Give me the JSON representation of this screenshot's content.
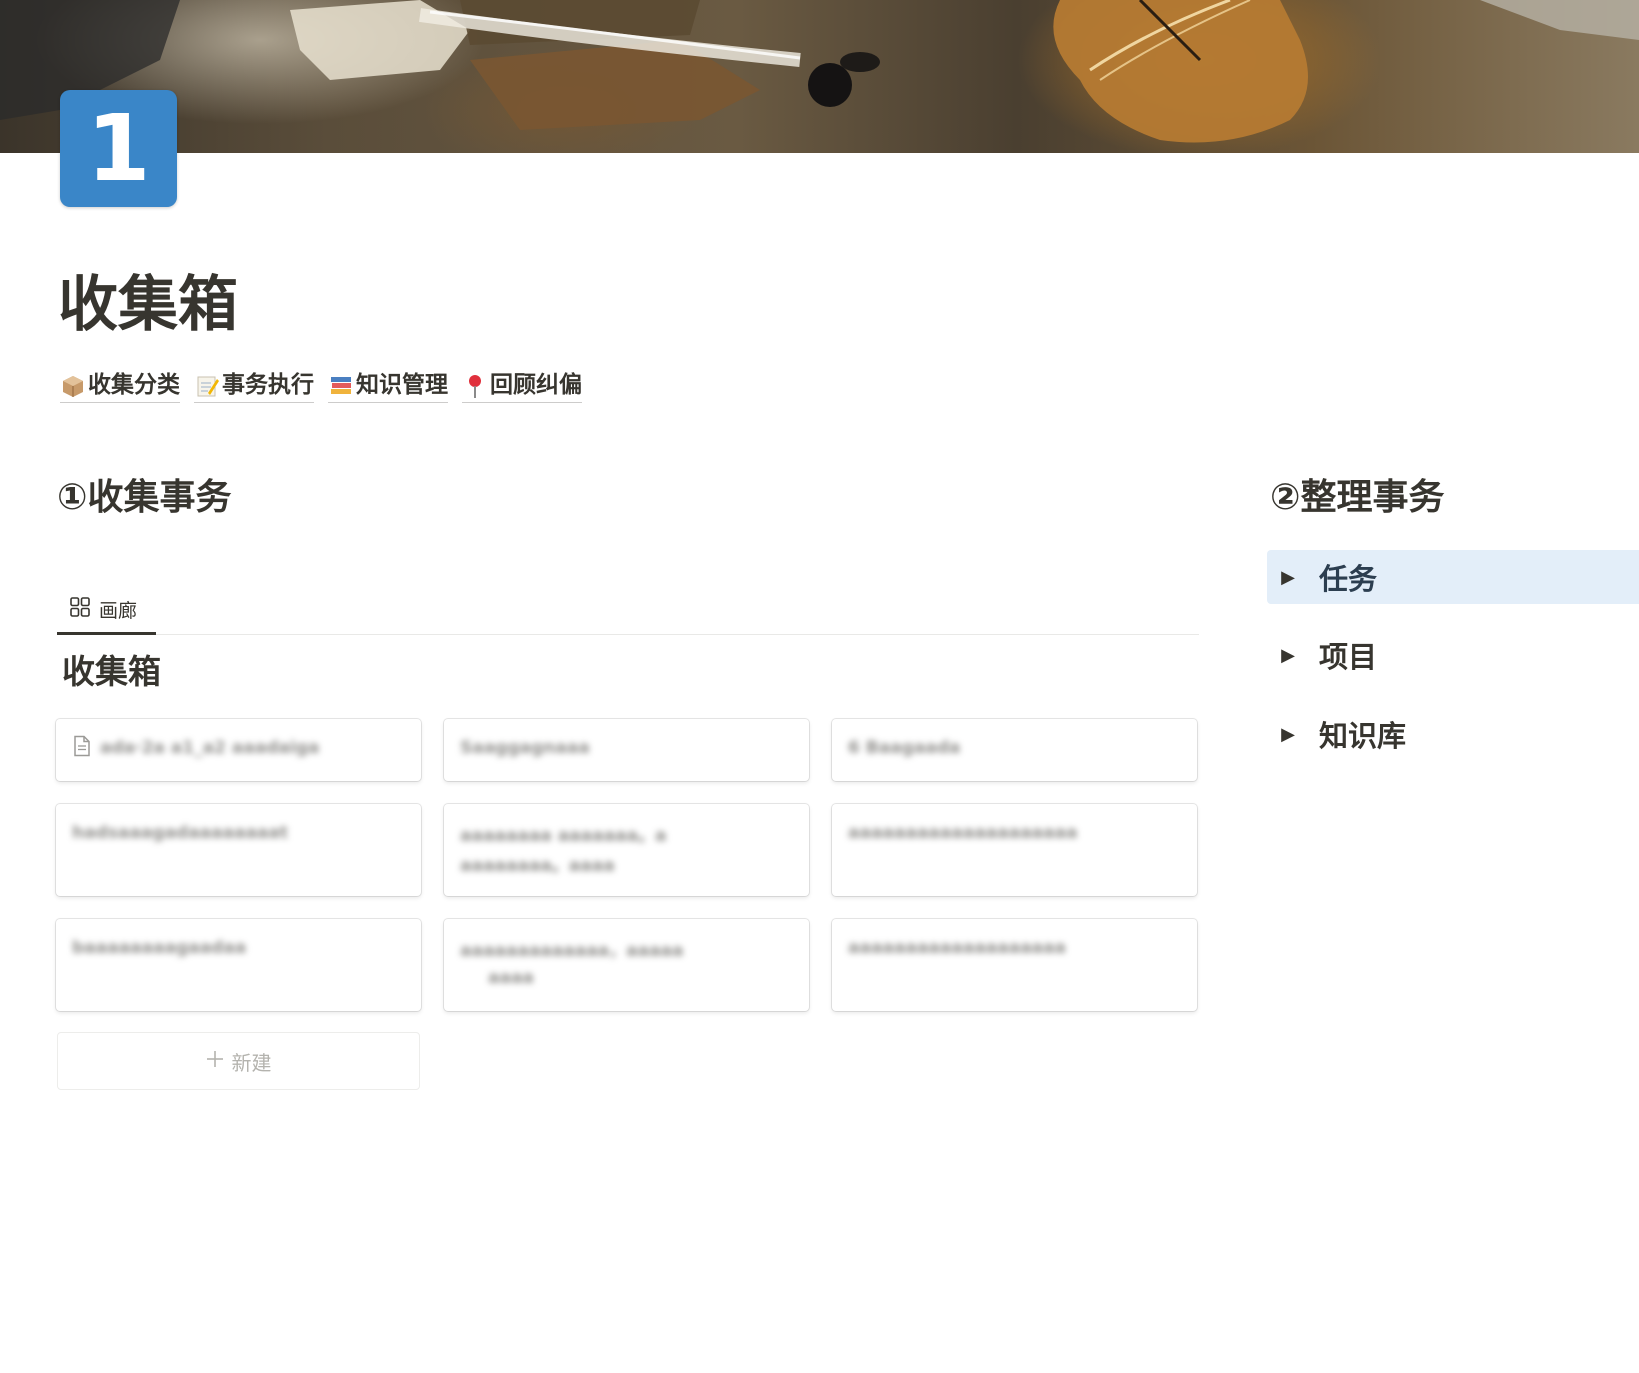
{
  "page": {
    "icon_text": "1",
    "title": "收集箱"
  },
  "nav_links": [
    {
      "label": "收集分类",
      "icon": "package-icon"
    },
    {
      "label": "事务执行",
      "icon": "memo-icon"
    },
    {
      "label": "知识管理",
      "icon": "books-icon"
    },
    {
      "label": "回顾纠偏",
      "icon": "pushpin-icon"
    }
  ],
  "sections": {
    "collect_heading": "①收集事务",
    "organize_heading": "②整理事务"
  },
  "database": {
    "view_tab_label": "画廊",
    "title": "收集箱",
    "new_label": "新建",
    "cards": [
      {
        "line1": "ada·2a a1_a2 aaadaiga",
        "line2": ""
      },
      {
        "line1": "Saaggagnaaa",
        "line2": ""
      },
      {
        "line1": "6 Baagaada",
        "line2": ""
      },
      {
        "line1": "hadsaaagadaaaaaaaat",
        "line2": ""
      },
      {
        "line1": "aaaaaaaa aaaaaaa。a",
        "line2": "aaaaaaaa。aaaa"
      },
      {
        "line1": "aaaaaaaaaaaaaaaaaaaa",
        "line2": ""
      },
      {
        "line1": "baaaaaaaagaadaa",
        "line2": ""
      },
      {
        "line1": "aaaaaaaaaaaaa，aaaaa",
        "line2": "aaaa"
      },
      {
        "line1": "aaaaaaaaaaaaaaaaaaa",
        "line2": ""
      }
    ]
  },
  "toggles": [
    {
      "label": "任务",
      "selected": true
    },
    {
      "label": "项目",
      "selected": false
    },
    {
      "label": "知识库",
      "selected": false
    }
  ],
  "colors": {
    "text": "#37352f",
    "icon_bg": "#3a86c8",
    "selected_bg": "#e3eef9"
  }
}
